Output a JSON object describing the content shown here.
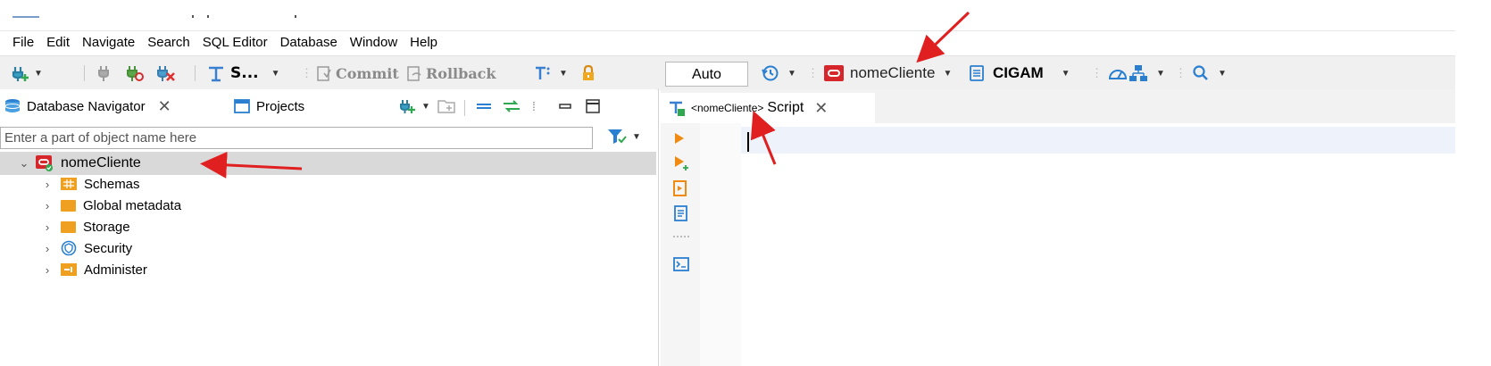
{
  "menubar": {
    "items": [
      "File",
      "Edit",
      "Navigate",
      "Search",
      "SQL Editor",
      "Database",
      "Window",
      "Help"
    ]
  },
  "toolbar": {
    "sql_label": "S...",
    "commit_label": "Commit",
    "rollback_label": "Rollback",
    "transaction_mode": "Auto",
    "connection_name": "nomeCliente",
    "schema_name": "CIGAM"
  },
  "navigator": {
    "tab_database": "Database Navigator",
    "tab_projects": "Projects",
    "search_placeholder": "Enter a part of object name here",
    "connection": "nomeCliente",
    "children": [
      "Schemas",
      "Global metadata",
      "Storage",
      "Security",
      "Administer"
    ]
  },
  "editor": {
    "tab_connection": "<nomeCliente>",
    "tab_label": "Script"
  },
  "colors": {
    "annotation_arrow": "#e02020",
    "oracle_red": "#d6262b",
    "folder_orange": "#f0a020",
    "current_line": "#eef2fa"
  }
}
